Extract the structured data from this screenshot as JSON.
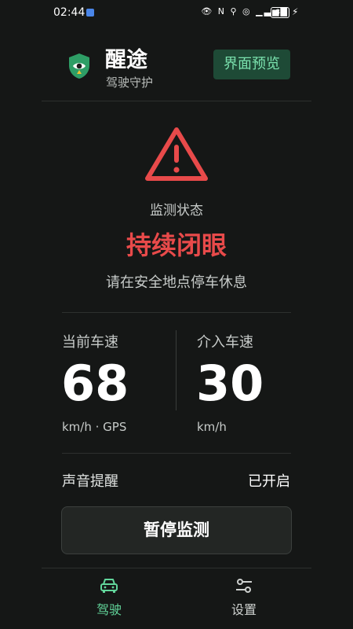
{
  "status_bar": {
    "time": "02:44",
    "battery": "84"
  },
  "header": {
    "app_name": "醒途",
    "subtitle": "驾驶守护",
    "preview_button": "界面预览",
    "logo_icon": "shield-eye-icon"
  },
  "monitor": {
    "status_label": "监测状态",
    "status_value": "持续闭眼",
    "hint": "请在安全地点停车休息",
    "alert_color": "#e84a4a",
    "warning_icon": "warning-triangle-icon"
  },
  "speeds": {
    "current": {
      "label": "当前车速",
      "value": "68",
      "unit": "km/h · GPS"
    },
    "intervene": {
      "label": "介入车速",
      "value": "30",
      "unit": "km/h"
    }
  },
  "sound": {
    "label": "声音提醒",
    "value": "已开启"
  },
  "pause_button": "暂停监测",
  "nav": {
    "items": [
      {
        "label": "驾驶",
        "icon": "car-icon",
        "active": true
      },
      {
        "label": "设置",
        "icon": "settings-sliders-icon",
        "active": false
      }
    ],
    "accent": "#62d69b"
  }
}
